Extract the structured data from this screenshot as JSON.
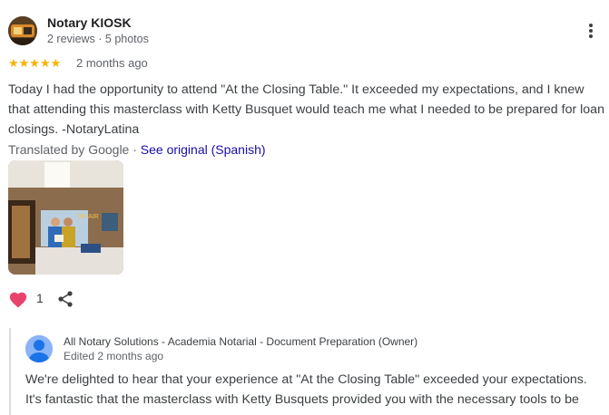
{
  "review": {
    "reviewer_name": "Notary KIOSK",
    "reviewer_meta": "2 reviews · 5 photos",
    "stars": "★★★★★",
    "time": "2 months ago",
    "text": "Today I had the opportunity to attend \"At the Closing Table.\" It exceeded my expectations, and I knew that attending this masterclass with Ketty Busquet would teach me what I needed to be prepared for loan closings. -NotaryLatina",
    "translated_by": "Translated by Google · ",
    "see_original": "See original (Spanish)",
    "photo_sign_text": "ON AIR",
    "like_count": "1"
  },
  "owner_reply": {
    "name": "All Notary Solutions - Academia Notarial - Document Preparation (Owner)",
    "edited": "Edited 2 months ago",
    "text": "We're delighted to hear that your experience at \"At the Closing Table\" exceeded your expectations. It's fantastic that the masterclass with Ketty Busquets provided you with the necessary tools to be"
  },
  "icons": {
    "more": "more-vert-icon",
    "like": "heart-icon",
    "share": "share-icon",
    "owner_avatar": "person-icon"
  },
  "colors": {
    "star": "#f4b400",
    "link": "#1a0dab",
    "heart": "#e8436b",
    "owner_avatar": "#8ab4f8"
  }
}
